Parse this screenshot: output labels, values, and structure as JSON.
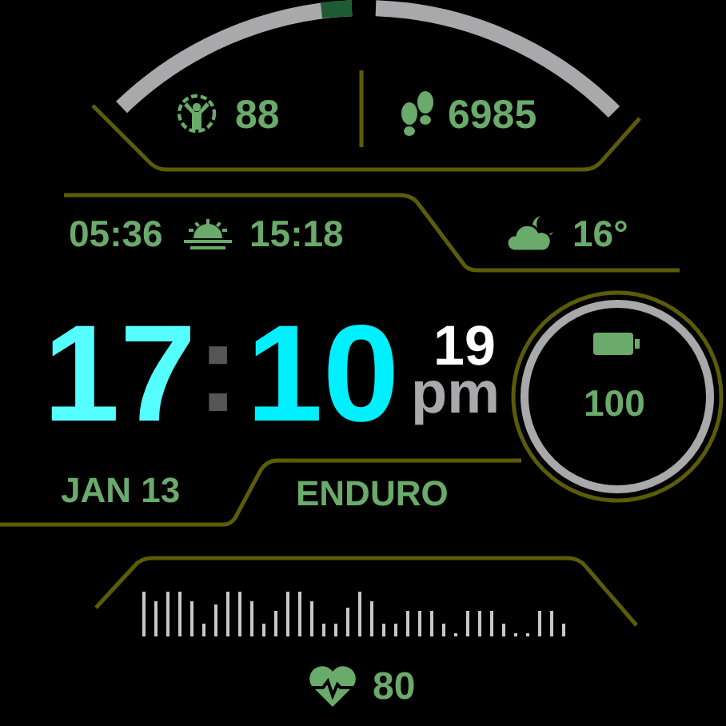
{
  "activity": {
    "intensity_minutes": "88",
    "steps": "6985"
  },
  "sun": {
    "sunrise": "05:36",
    "sunset": "15:18"
  },
  "weather": {
    "temperature": "16°"
  },
  "time": {
    "hours": "17",
    "separator": ":",
    "minutes": "10",
    "seconds": "19",
    "meridiem": "pm"
  },
  "battery": {
    "percent": "100"
  },
  "date": "JAN 13",
  "activity_profile": "ENDURO",
  "heart_rate": "80"
}
